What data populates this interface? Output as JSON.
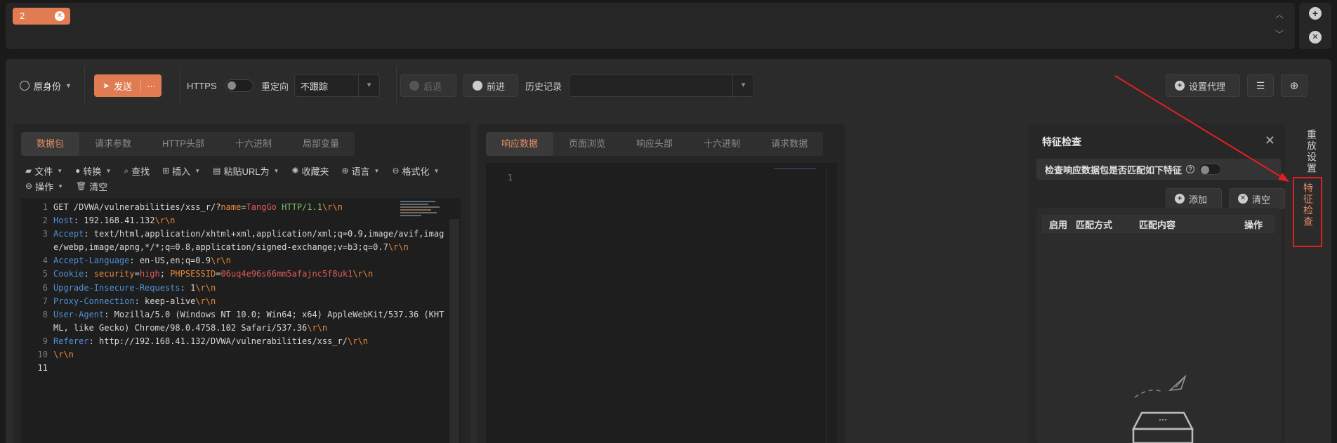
{
  "session_tabs": {
    "active_tab": "2"
  },
  "toolbar": {
    "identity_label": "原身份",
    "send_label": "发送",
    "more_label": "···",
    "https_label": "HTTPS",
    "redirect_label": "重定向",
    "redirect_value": "不跟踪",
    "back_label": "后退",
    "forward_label": "前进",
    "history_label": "历史记录",
    "proxy_label": "设置代理"
  },
  "request_panel": {
    "tabs": [
      "数据包",
      "请求参数",
      "HTTP头部",
      "十六进制",
      "局部变量"
    ],
    "active_tab": "数据包",
    "tools_row1": [
      "文件",
      "转换",
      "查找",
      "插入",
      "粘贴URL为",
      "收藏夹",
      "语言",
      "格式化"
    ],
    "tools_row2": [
      "操作",
      "清空"
    ],
    "line_numbers": [
      "1",
      "2",
      "3",
      "",
      "4",
      "5",
      "6",
      "7",
      "8",
      "",
      "9",
      "10",
      "11"
    ]
  },
  "response_panel": {
    "tabs": [
      "响应数据",
      "页面浏览",
      "响应头部",
      "十六进制",
      "请求数据"
    ],
    "active_tab": "响应数据",
    "line_numbers": [
      "1"
    ]
  },
  "feature_panel": {
    "title": "特征检查",
    "check_label": "检查响应数据包是否匹配如下特征",
    "add_label": "添加",
    "clear_label": "清空",
    "columns": [
      "启用",
      "匹配方式",
      "匹配内容",
      "操作"
    ]
  },
  "right_strip": {
    "reset_label": "重放设置",
    "feature_label": "特征检查"
  },
  "colors": {
    "accent": "#e07b52",
    "annotation": "#e02020"
  }
}
